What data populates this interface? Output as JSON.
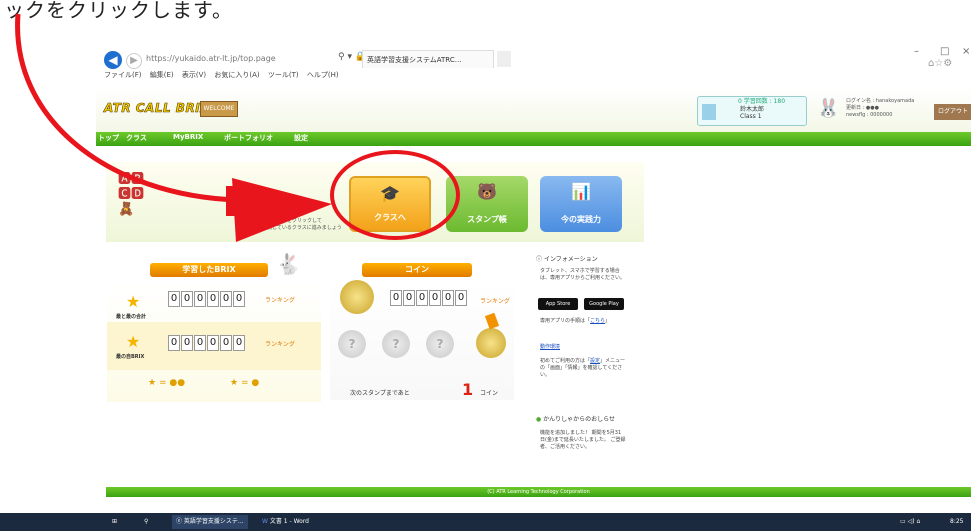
{
  "caption": "ックをクリックします。",
  "browser": {
    "url": "https://yukaido.atr-lt.jp/top.page",
    "tab_title": "英語学習支援システムATRC…",
    "menu": [
      "ファイル(F)",
      "編集(E)",
      "表示(V)",
      "お気に入り(A)",
      "ツール(T)",
      "ヘルプ(H)"
    ],
    "min": "–",
    "max": "□",
    "close": "×"
  },
  "header": {
    "logo": "ATR CALL BRIX",
    "logo_sign": "WELCOME",
    "user_top": "0 学習回数 : 180",
    "user_name": "鈴木太郎",
    "user_class": "Class 1",
    "links": [
      "ログイン名 : hanakoyamada",
      "更新日 : ●●●",
      "newsflg : 0000000"
    ],
    "logout": "ログアウト"
  },
  "nav": {
    "items": [
      "トップ",
      "クラス",
      "MyBRIX",
      "ポートフォリオ",
      "設定"
    ]
  },
  "hero": {
    "hint_lines": [
      "下のボタンをクリックして",
      "受講しているクラスに進みましょう"
    ],
    "cards": [
      {
        "label": "クラスへ",
        "icon": "🎓"
      },
      {
        "label": "スタンプ帳",
        "icon": "🐻"
      },
      {
        "label": "今の実践力",
        "icon": "📊"
      }
    ]
  },
  "brix": {
    "title": "学習したBRIX",
    "total_label": "最と最の合計",
    "total_value": [
      "0",
      "0",
      "0",
      "0",
      "0",
      "0"
    ],
    "month_label": "最の自BRIX",
    "month_value": [
      "0",
      "0",
      "0",
      "0",
      "0",
      "0"
    ],
    "ranking": "ランキング",
    "legend": [
      "= ●●",
      "= ●"
    ]
  },
  "coin": {
    "title": "コイン",
    "value": [
      "0",
      "0",
      "0",
      "0",
      "0",
      "0"
    ],
    "ranking": "ランキング",
    "remain_label": "次のスタンプまであと",
    "remain_num": "1",
    "remain_unit": "コイン"
  },
  "info": {
    "title": "インフォメーション",
    "item1": "タブレット、スマホで学習する場合は、専用アプリからご利用ください。",
    "app_store": "App Store",
    "google_play": "Google Play",
    "item2_a": "専用アプリの手順は「",
    "item2_link": "こちら",
    "item2_b": "」",
    "item3": "動作環境",
    "item4_a": "初めてご利用の方は「",
    "item4_link": "設定",
    "item4_b": "」メニューの「画面」「情報」を確認してください。",
    "admin_title": "かんりしゃからのおしらせ",
    "admin_body": "機能を追加しました！ 期間を5月31日(金)まで延長いたしました。 ご登録者、ご活用ください。"
  },
  "footer": "(C) ATR Learning Technology Corporation",
  "taskbar": {
    "app1": "英語学習支援システ...",
    "app2": "文書 1 - Word",
    "clock": "8:25"
  }
}
